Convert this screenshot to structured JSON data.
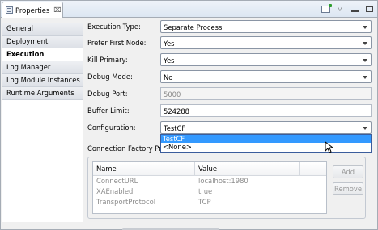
{
  "tab": {
    "label": "Properties",
    "close": "⌧"
  },
  "view_tools": {
    "menu": "▽"
  },
  "nav": {
    "items": [
      {
        "label": "General"
      },
      {
        "label": "Deployment"
      },
      {
        "label": "Execution"
      },
      {
        "label": "Log Manager"
      },
      {
        "label": "Log Module Instances"
      },
      {
        "label": "Runtime Arguments"
      }
    ],
    "active": "Execution"
  },
  "form": {
    "execution_type": {
      "label": "Execution Type:",
      "value": "Separate Process"
    },
    "prefer_first_node": {
      "label": "Prefer First Node:",
      "value": "Yes"
    },
    "kill_primary": {
      "label": "Kill Primary:",
      "value": "Yes"
    },
    "debug_mode": {
      "label": "Debug Mode:",
      "value": "No"
    },
    "debug_port": {
      "label": "Debug Port:",
      "value": "5000"
    },
    "buffer_limit": {
      "label": "Buffer Limit:",
      "value": "524288"
    },
    "configuration": {
      "label": "Configuration:",
      "value": "TestCF"
    },
    "connection_factory": {
      "label": "Connection Factory Pro"
    }
  },
  "dropdown": {
    "options": [
      {
        "label": "TestCF"
      },
      {
        "label": "<None>"
      }
    ]
  },
  "table": {
    "headers": {
      "name": "Name",
      "value": "Value"
    },
    "rows": [
      {
        "name": "ConnectURL",
        "value": "localhost:1980"
      },
      {
        "name": "XAEnabled",
        "value": "true"
      },
      {
        "name": "TransportProtocol",
        "value": "TCP"
      }
    ]
  },
  "buttons": {
    "add": "Add",
    "remove": "Remove"
  }
}
